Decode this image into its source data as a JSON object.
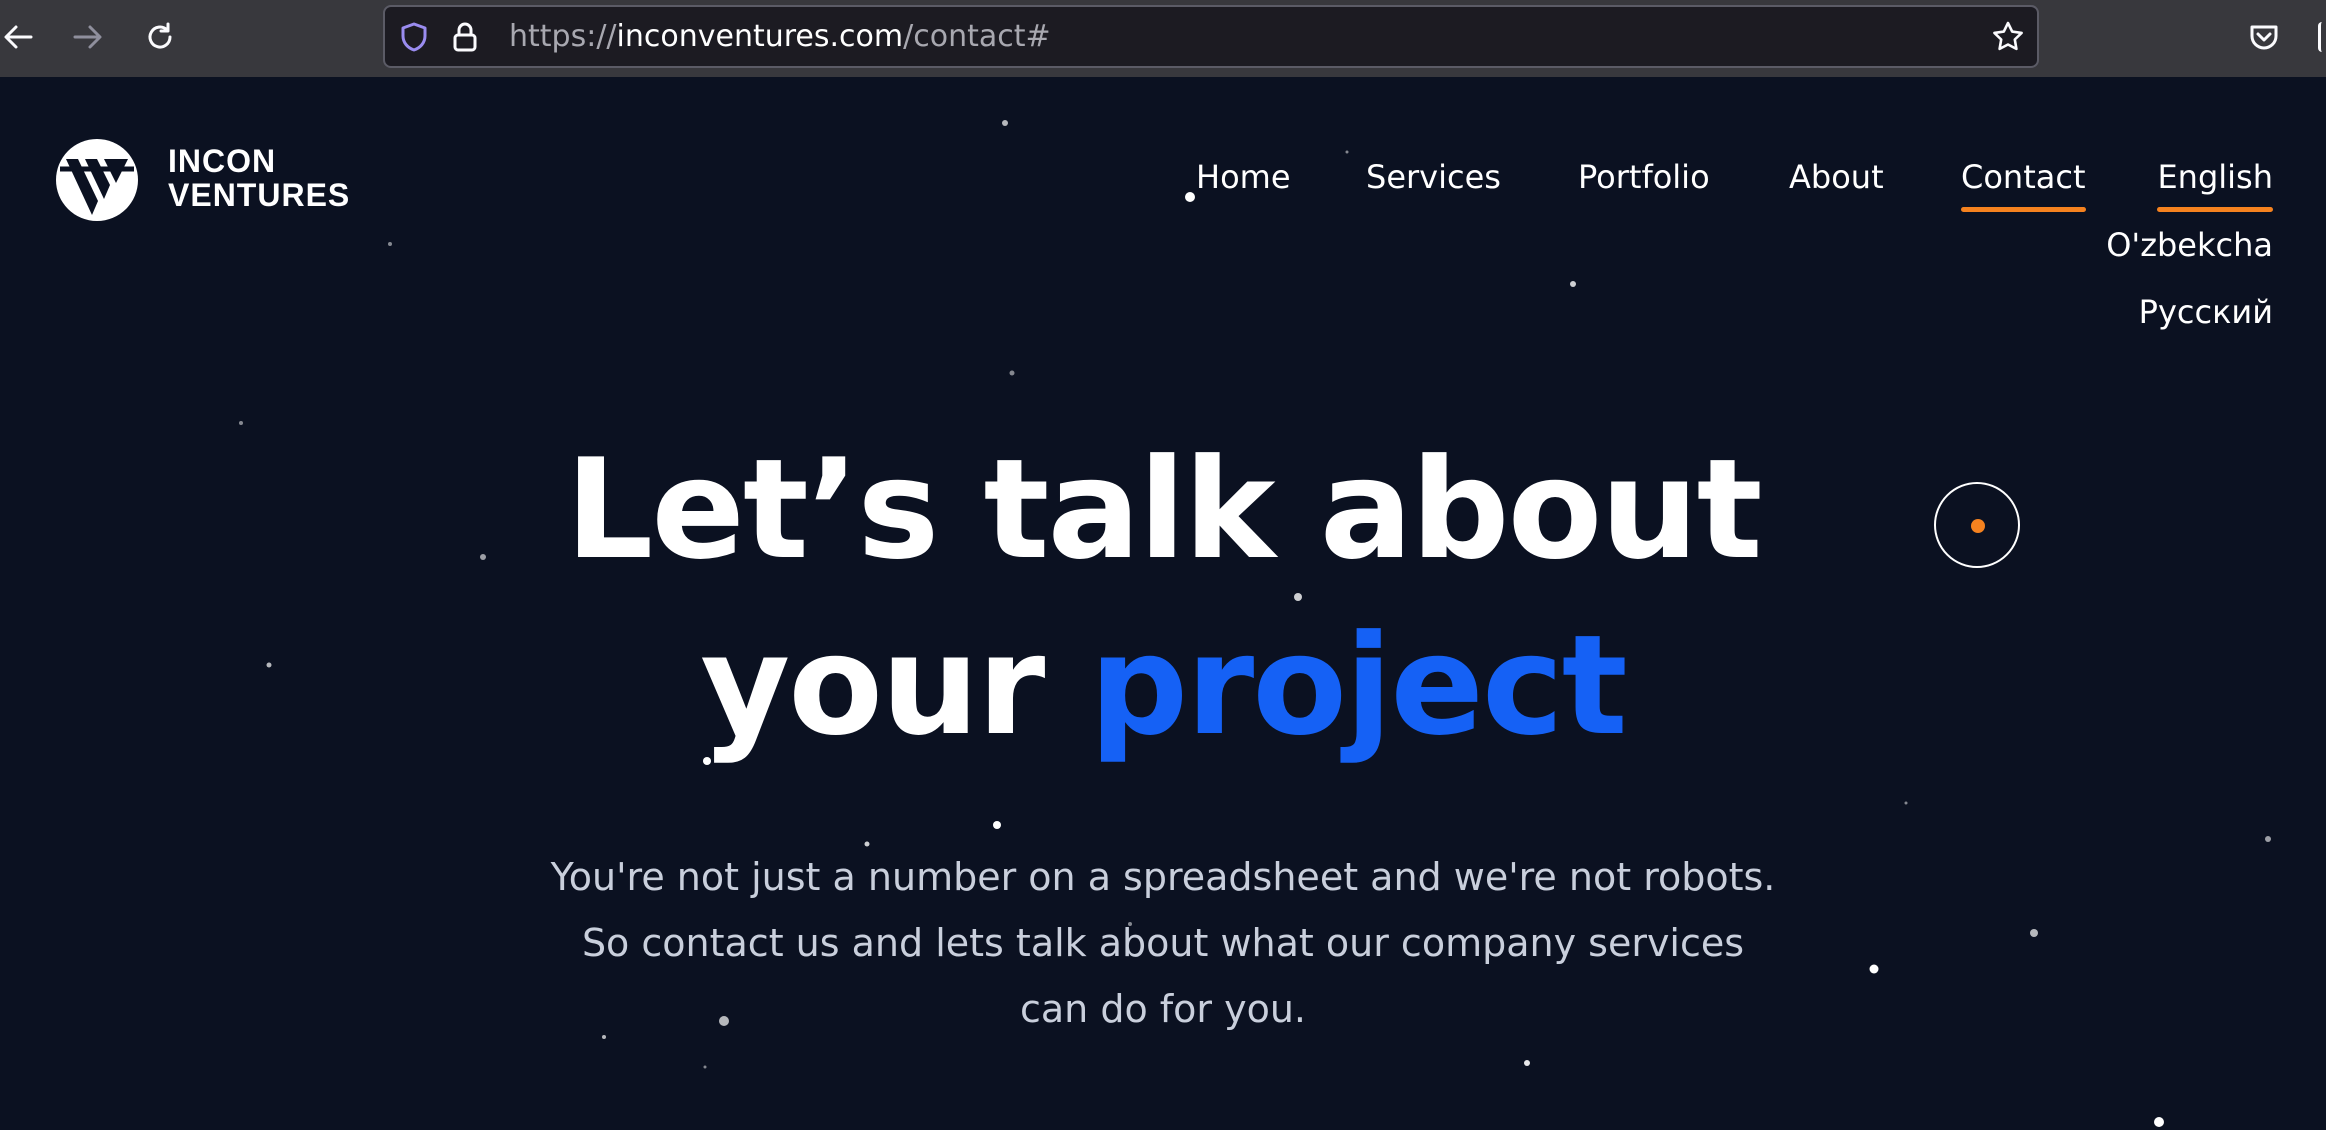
{
  "browser": {
    "url_prefix": "https://",
    "url_domain": "inconventures.com",
    "url_path": "/contact#",
    "icons": [
      "back-arrow-icon",
      "forward-arrow-icon",
      "reload-icon",
      "shield-icon",
      "lock-icon",
      "star-icon",
      "pocket-icon"
    ]
  },
  "brand": {
    "line1": "INCON",
    "line2": "VENTURES"
  },
  "nav": {
    "home": "Home",
    "services": "Services",
    "portfolio": "Portfolio",
    "about": "About",
    "contact": "Contact",
    "active": "Contact"
  },
  "language": {
    "current": "English",
    "options": [
      "O'zbekcha",
      "Русский"
    ]
  },
  "hero": {
    "title_line1": "Let’s talk about",
    "title_line2_plain": "your",
    "title_line2_accent": "project",
    "subtitle_line1": "You're not just a number on a spreadsheet and we're not robots.",
    "subtitle_line2": "So contact us and lets talk about what our company services",
    "subtitle_line3": "can do for you."
  },
  "colors": {
    "background": "#0b1121",
    "accent_blue": "#1561f5",
    "accent_orange": "#f5821f",
    "text_muted": "#c9cfdc"
  }
}
